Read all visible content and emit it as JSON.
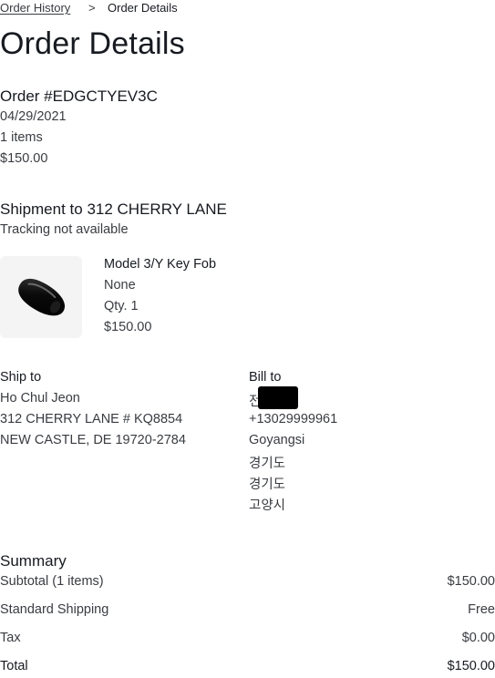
{
  "breadcrumb": {
    "parent_label": "Order History",
    "separator": ">",
    "current_label": "Order Details"
  },
  "page_title": "Order Details",
  "order": {
    "number": "Order #EDGCTYEV3C",
    "date": "04/29/2021",
    "items_count": "1 items",
    "total": "$150.00"
  },
  "shipment": {
    "heading": "Shipment to 312 CHERRY LANE",
    "tracking_status": "Tracking not available",
    "product": {
      "name": "Model 3/Y Key Fob",
      "option": "None",
      "quantity": "Qty. 1",
      "price": "$150.00",
      "image_icon": "key-fob-image"
    }
  },
  "ship_to": {
    "heading": "Ship to",
    "name": "Ho Chul Jeon",
    "address_line1": "312 CHERRY LANE # KQ8854",
    "address_line2": "NEW CASTLE, DE 19720-2784"
  },
  "bill_to": {
    "heading": "Bill to",
    "name_visible_fragment": "전",
    "phone": "+13029999961",
    "city": "Goyangsi",
    "province": "경기도",
    "province_repeat": "경기도",
    "district": "고양시"
  },
  "summary": {
    "heading": "Summary",
    "rows": [
      {
        "label": "Subtotal (1 items)",
        "value": "$150.00"
      },
      {
        "label": "Standard Shipping",
        "value": "Free"
      },
      {
        "label": "Tax",
        "value": "$0.00"
      },
      {
        "label": "Total",
        "value": "$150.00"
      }
    ]
  },
  "colors": {
    "text_primary": "#171a20",
    "text_secondary": "#393c41",
    "thumb_bg": "#f4f4f4"
  }
}
